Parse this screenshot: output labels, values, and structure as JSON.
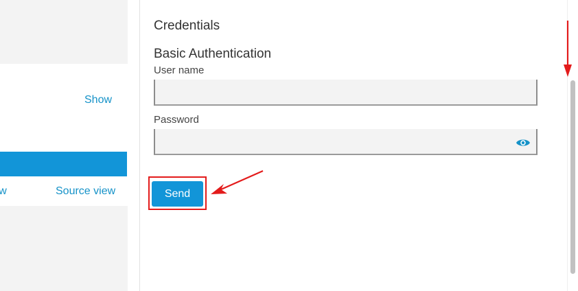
{
  "left_panel": {
    "show_link": "Show",
    "tabs": {
      "table_view": "ble view",
      "source_view": "Source view"
    }
  },
  "credentials": {
    "title": "Credentials",
    "basic_auth_title": "Basic Authentication",
    "username": {
      "label": "User name",
      "value": ""
    },
    "password": {
      "label": "Password",
      "value": ""
    },
    "send_label": "Send"
  },
  "icons": {
    "password_toggle": "eye-icon"
  },
  "colors": {
    "accent": "#1295d8",
    "annotation": "#e31b1b"
  }
}
